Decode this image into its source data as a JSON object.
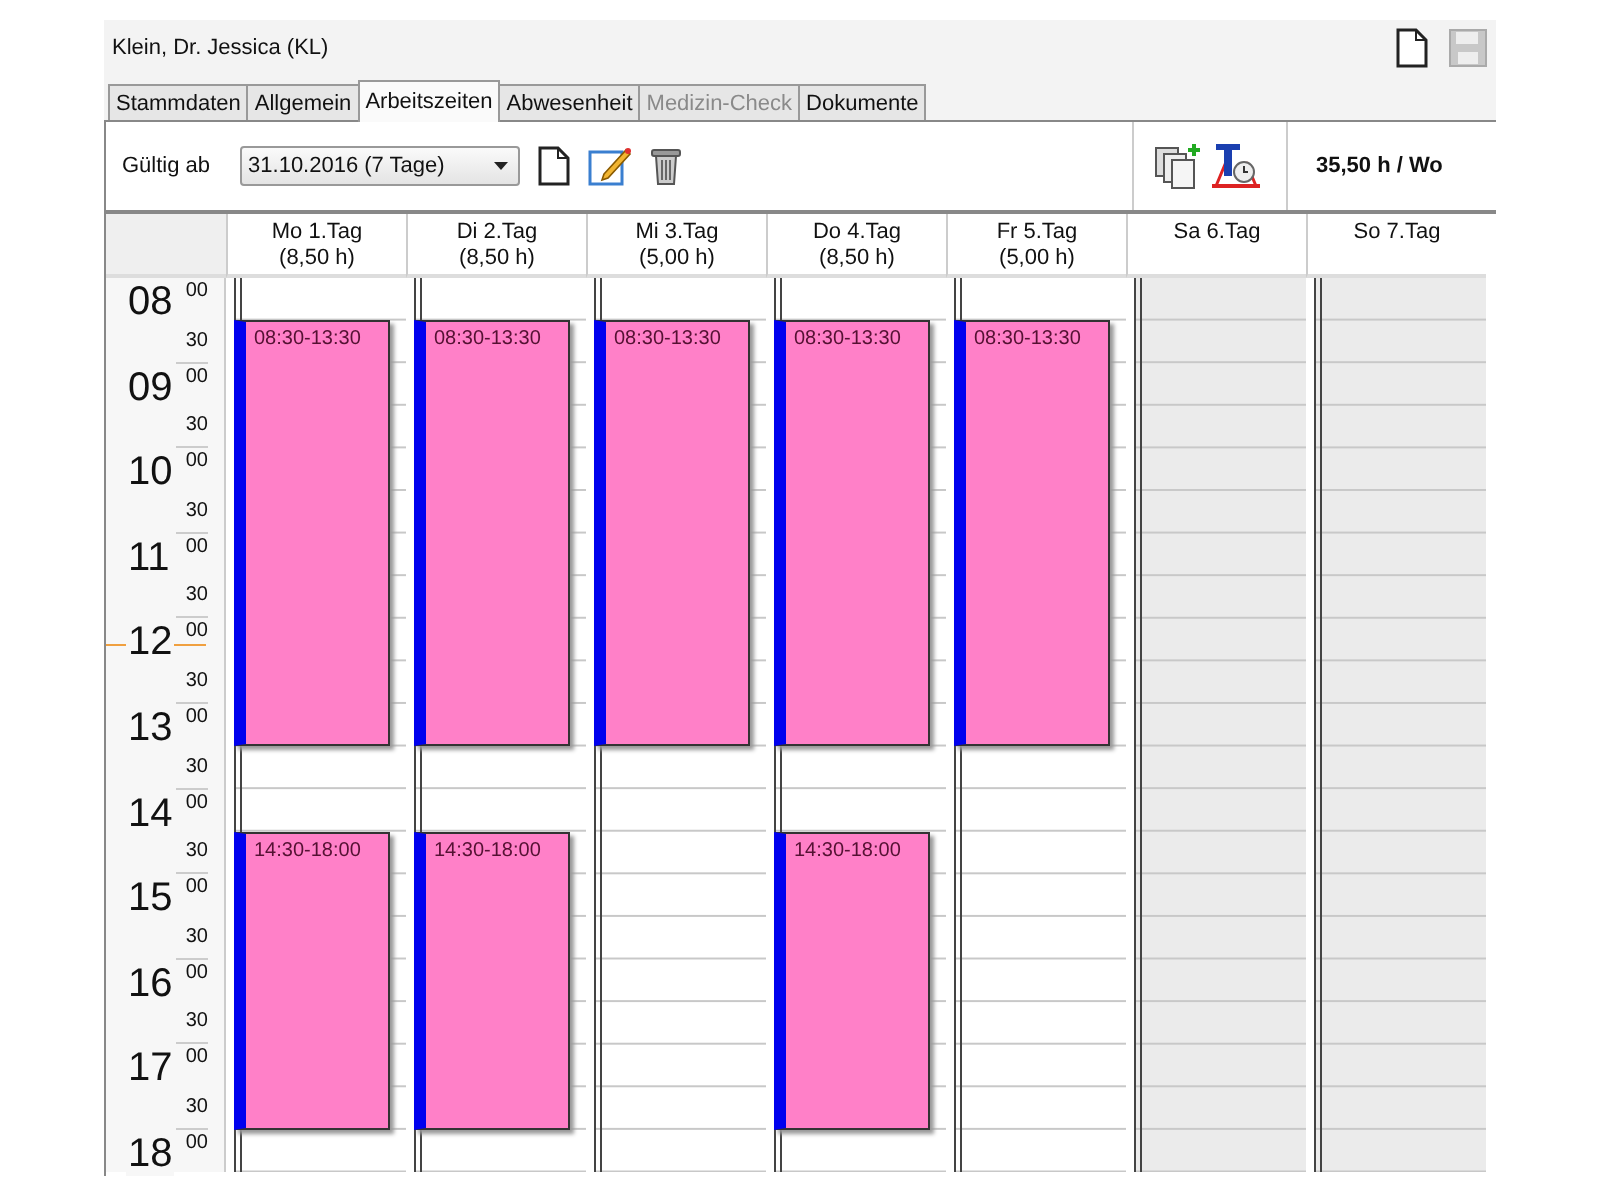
{
  "window": {
    "title": "Klein, Dr. Jessica (KL)"
  },
  "tabs": [
    {
      "label": "Stammdaten",
      "selected": false,
      "disabled": false
    },
    {
      "label": "Allgemein",
      "selected": false,
      "disabled": false
    },
    {
      "label": "Arbeitszeiten",
      "selected": true,
      "disabled": false
    },
    {
      "label": "Abwesenheit",
      "selected": false,
      "disabled": false
    },
    {
      "label": "Medizin-Check",
      "selected": false,
      "disabled": true
    },
    {
      "label": "Dokumente",
      "selected": false,
      "disabled": false
    }
  ],
  "toolbar": {
    "valid_from_label": "Gültig ab",
    "valid_from_value": "31.10.2016 (7 Tage)",
    "weekly_total": "35,50 h / Wo"
  },
  "time_rows": [
    {
      "hour": "08",
      "minutes": [
        "00",
        "30"
      ],
      "current": false
    },
    {
      "hour": "09",
      "minutes": [
        "00",
        "30"
      ],
      "current": false
    },
    {
      "hour": "10",
      "minutes": [
        "00",
        "30"
      ],
      "current": false
    },
    {
      "hour": "11",
      "minutes": [
        "00",
        "30"
      ],
      "current": false
    },
    {
      "hour": "12",
      "minutes": [
        "00",
        "30"
      ],
      "current": true
    },
    {
      "hour": "13",
      "minutes": [
        "00",
        "30"
      ],
      "current": false
    },
    {
      "hour": "14",
      "minutes": [
        "00",
        "30"
      ],
      "current": false
    },
    {
      "hour": "15",
      "minutes": [
        "00",
        "30"
      ],
      "current": false
    },
    {
      "hour": "16",
      "minutes": [
        "00",
        "30"
      ],
      "current": false
    },
    {
      "hour": "17",
      "minutes": [
        "00",
        "30"
      ],
      "current": false
    },
    {
      "hour": "18",
      "minutes": [
        "00"
      ],
      "current": false
    }
  ],
  "days": [
    {
      "label": "Mo 1.Tag",
      "hours": "(8,50 h)",
      "free": false,
      "shifts": [
        "08:30-13:30",
        "14:30-18:00"
      ]
    },
    {
      "label": "Di 2.Tag",
      "hours": "(8,50 h)",
      "free": false,
      "shifts": [
        "08:30-13:30",
        "14:30-18:00"
      ]
    },
    {
      "label": "Mi 3.Tag",
      "hours": "(5,00 h)",
      "free": false,
      "shifts": [
        "08:30-13:30"
      ]
    },
    {
      "label": "Do 4.Tag",
      "hours": "(8,50 h)",
      "free": false,
      "shifts": [
        "08:30-13:30",
        "14:30-18:00"
      ]
    },
    {
      "label": "Fr 5.Tag",
      "hours": "(5,00 h)",
      "free": false,
      "shifts": [
        "08:30-13:30"
      ]
    },
    {
      "label": "Sa 6.Tag",
      "free": true
    },
    {
      "label": "So 7.Tag",
      "free": true
    }
  ]
}
